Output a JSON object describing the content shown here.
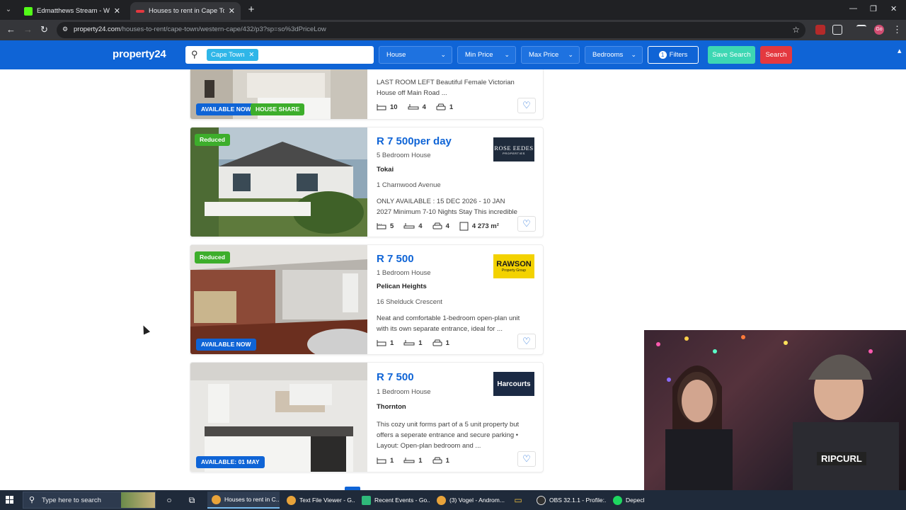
{
  "browser": {
    "tabs": [
      {
        "title": "Edmatthews Stream - Watch Li",
        "active": false,
        "favicon_color": "#53fc18"
      },
      {
        "title": "Houses to rent in Cape Town : C",
        "active": true,
        "favicon_color": "#e4383f"
      }
    ],
    "url_host": "property24.com",
    "url_path": "/houses-to-rent/cape-town/western-cape/432/p3?sp=so%3dPriceLow",
    "profile_label": "Go"
  },
  "site": {
    "logo": "property24",
    "search_chip": "Cape Town",
    "dropdowns": [
      "House",
      "Min Price",
      "Max Price",
      "Bedrooms"
    ],
    "filters_count": "1",
    "filters_label": "Filters",
    "save_search": "Save Search",
    "search": "Search"
  },
  "listings": [
    {
      "badges": [
        "AVAILABLE NOW",
        "HOUSE SHARE"
      ],
      "description": "LAST ROOM LEFT Beautiful Female Victorian House off Main Road ...",
      "features": {
        "bedrooms": "10",
        "bathrooms": "4",
        "parking": "1"
      }
    },
    {
      "top_badge": "Reduced",
      "price": "R 7 500per day",
      "type": "5 Bedroom House",
      "suburb": "Tokai",
      "street": "1 Charnwood Avenue",
      "description": "ONLY AVAILABLE : 15 DEC 2026 - 10 JAN 2027 Minimum 7-10 Nights Stay This incredible ...",
      "features": {
        "bedrooms": "5",
        "bathrooms": "4",
        "parking": "4",
        "size": "4 273 m²"
      },
      "agency": "ROSE EEDES",
      "agency_sub": "PROPERTIES"
    },
    {
      "top_badge": "Reduced",
      "bottom_badge": "AVAILABLE NOW",
      "price": "R 7 500",
      "type": "1 Bedroom House",
      "suburb": "Pelican Heights",
      "street": "16 Shelduck Crescent",
      "description": "Neat and comfortable 1-bedroom open-plan unit with its own separate entrance, ideal for ...",
      "features": {
        "bedrooms": "1",
        "bathrooms": "1",
        "parking": "1"
      },
      "agency": "RAWSON",
      "agency_sub": "Property Group"
    },
    {
      "bottom_badge": "AVAILABLE: 01 MAY",
      "price": "R 7 500",
      "type": "1 Bedroom House",
      "suburb": "Thornton",
      "description": "This cozy unit forms part of a 5 unit property but offers a seperate entrance and secure parking • Layout: Open-plan bedroom and ...",
      "features": {
        "bedrooms": "1",
        "bathrooms": "1",
        "parking": "1"
      },
      "agency": "Harcourts"
    }
  ],
  "webcam": {
    "shirt_text": "RIPCURL"
  },
  "taskbar": {
    "search_placeholder": "Type here to search",
    "items": [
      "Houses to rent in C...",
      "Text File Viewer - G...",
      "Recent Events - Go...",
      "(3) Vogel - Androm...",
      "OBS 32.1.1 - Profile:...",
      "Depech"
    ]
  },
  "colors": {
    "brand_blue": "#0f64d6",
    "save_green": "#3dd7b3",
    "search_red": "#e4383f",
    "badge_green": "#3dae2b"
  }
}
